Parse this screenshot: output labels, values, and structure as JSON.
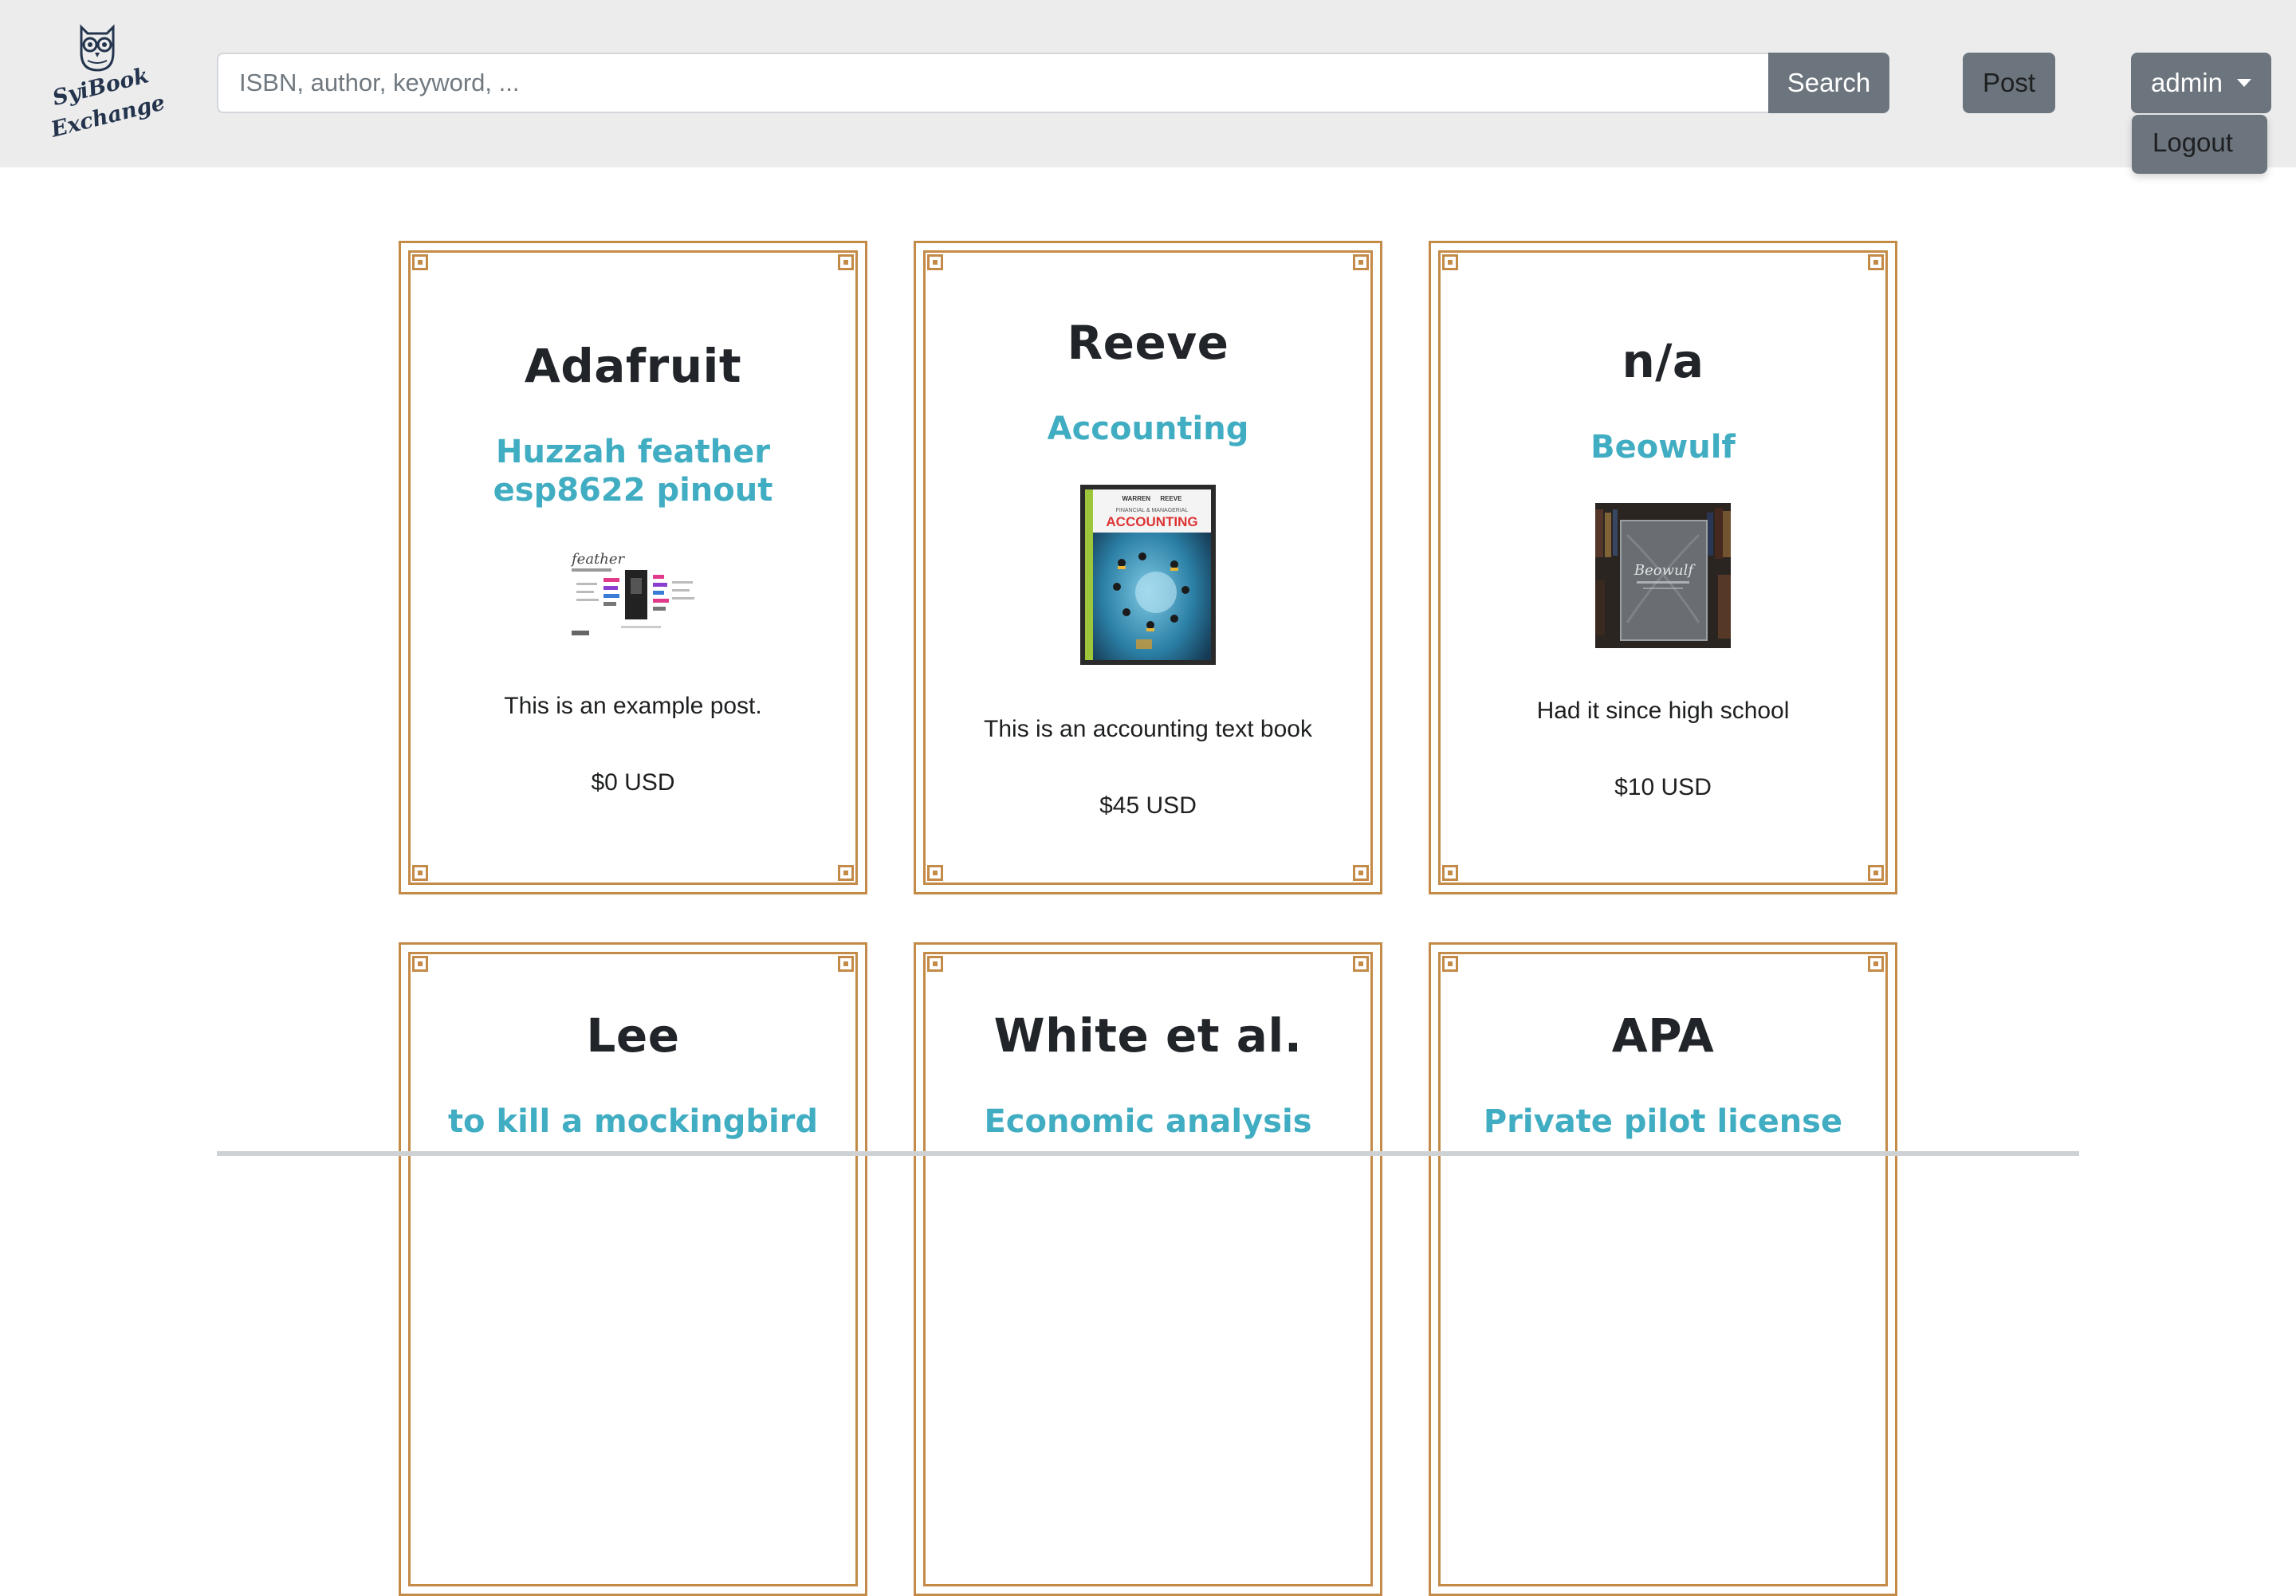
{
  "brand": {
    "logo_text": [
      "SyiBook",
      "Exchange"
    ],
    "logo_icon": "owl-icon"
  },
  "search": {
    "placeholder": "ISBN, author, keyword, ...",
    "value": "",
    "button_label": "Search"
  },
  "nav": {
    "post_label": "Post",
    "user_label": "admin",
    "dropdown_items": [
      "Logout"
    ]
  },
  "posts": [
    {
      "author": "Adafruit",
      "title": [
        "Huzzah feather",
        "esp8622 pinout"
      ],
      "image": "pinout-diagram",
      "description": "This is an example post.",
      "price": "$0 USD"
    },
    {
      "author": "Reeve",
      "title": [
        "Accounting"
      ],
      "image": "accounting-book-cover",
      "description": "This is an accounting text book",
      "price": "$45 USD"
    },
    {
      "author": "n/a",
      "title": [
        "Beowulf"
      ],
      "image": "beowulf-book-cover",
      "description": "Had it since high school",
      "price": "$10 USD"
    },
    {
      "author": "Lee",
      "title": [
        "to kill a mockingbird"
      ]
    },
    {
      "author": "White et al.",
      "title": [
        "Economic analysis"
      ]
    },
    {
      "author": "APA",
      "title": [
        "Private pilot license"
      ]
    }
  ],
  "colors": {
    "navbar_bg": "#ececed",
    "button_grey": "#6c757d",
    "card_border": "#c48a47",
    "title_link": "#41adc2",
    "text_dark": "#212529"
  },
  "book_cover_text": {
    "accounting": [
      "WARREN",
      "REEVE",
      "FINANCIAL & MANAGERIAL",
      "ACCOUNTING"
    ],
    "beowulf": "Beowulf",
    "feather": "feather"
  }
}
